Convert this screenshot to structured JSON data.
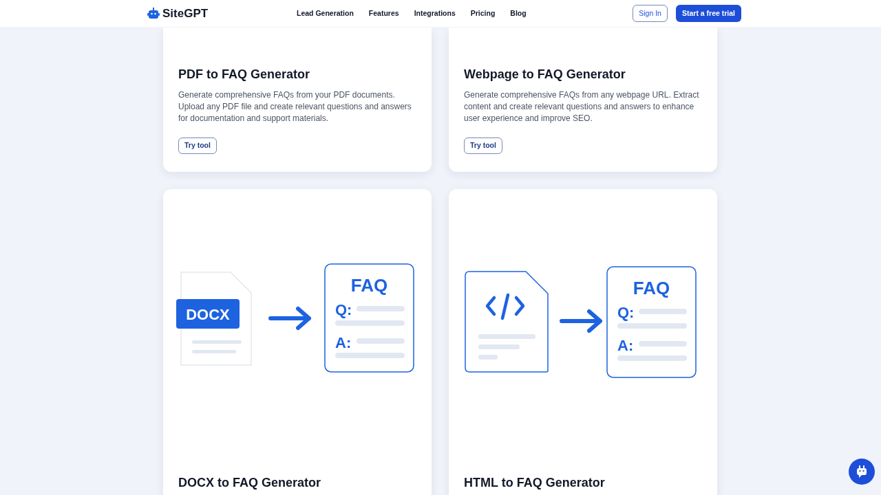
{
  "nav": {
    "logo": "SiteGPT",
    "links": [
      "Lead Generation",
      "Features",
      "Integrations",
      "Pricing",
      "Blog"
    ],
    "sign_in": "Sign In",
    "cta": "Start a free trial"
  },
  "cards": [
    {
      "title": "PDF to FAQ Generator",
      "description": "Generate comprehensive FAQs from your PDF documents. Upload any PDF file and create relevant questions and answers for documentation and support materials.",
      "button": "Try tool"
    },
    {
      "title": "Webpage to FAQ Generator",
      "description": "Generate comprehensive FAQs from any webpage URL. Extract content and create relevant questions and answers to enhance user experience and improve SEO.",
      "button": "Try tool"
    },
    {
      "title": "DOCX to FAQ Generator",
      "illustration": {
        "kind": "docx",
        "badge": "DOCX",
        "faq": "FAQ",
        "q": "Q:",
        "a": "A:"
      }
    },
    {
      "title": "HTML to FAQ Generator",
      "illustration": {
        "kind": "html",
        "faq": "FAQ",
        "q": "Q:",
        "a": "A:"
      }
    }
  ]
}
